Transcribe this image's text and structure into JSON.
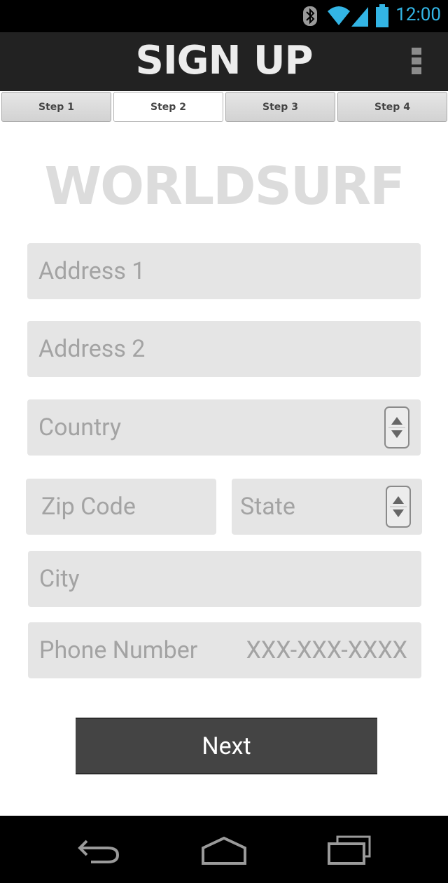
{
  "status_bar": {
    "time": "12:00",
    "accent": "#33b5e5"
  },
  "app_bar": {
    "title": "SIGN UP"
  },
  "steps": [
    {
      "label": "Step 1"
    },
    {
      "label": "Step 2"
    },
    {
      "label": "Step 3"
    },
    {
      "label": "Step 4"
    }
  ],
  "logo": {
    "text": "WORLDSURF"
  },
  "form": {
    "address1": {
      "placeholder": "Address 1"
    },
    "address2": {
      "placeholder": "Address 2"
    },
    "country": {
      "placeholder": "Country"
    },
    "zip": {
      "placeholder": "Zip Code"
    },
    "state": {
      "placeholder": "State"
    },
    "city": {
      "placeholder": "City"
    },
    "phone": {
      "placeholder": "Phone Number",
      "hint": "XXX-XXX-XXXX"
    }
  },
  "next_button": {
    "label": "Next"
  },
  "icons": {
    "bluetooth": "bluetooth-icon",
    "wifi": "wifi-icon",
    "signal": "signal-icon",
    "battery": "battery-icon",
    "overflow": "overflow-menu-icon",
    "back": "back-icon",
    "home": "home-icon",
    "recents": "recent-apps-icon"
  }
}
